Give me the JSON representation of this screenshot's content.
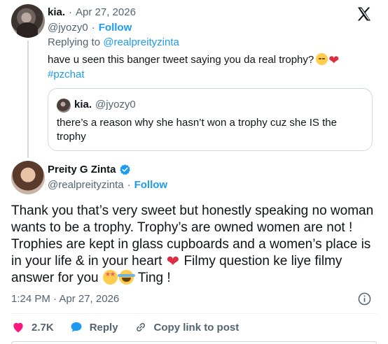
{
  "reply_tweet": {
    "display_name": "kia.",
    "date": "Apr 27, 2026",
    "handle": "@jyozy0",
    "follow_label": "Follow",
    "replying_prefix": "Replying to ",
    "replying_handle": "@realpreityzinta",
    "text": "have u seen this banger tweet saying you da real trophy?",
    "hashtag": "#pzchat",
    "emojis": [
      "relieved-face-icon",
      "red-heart-icon"
    ],
    "quoted": {
      "display_name": "kia.",
      "handle": "@jyozy0",
      "text": "there’s a reason why she hasn’t won a trophy cuz she IS the trophy"
    }
  },
  "main_tweet": {
    "display_name": "Preity G Zinta",
    "handle": "@realpreityzinta",
    "follow_label": "Follow",
    "text_part1": "Thank you that’s very sweet but honestly speaking no woman wants to be a trophy. Trophy’s are owned women are not ! Trophies are kept in glass cupboards and a women’s place is in your life & in your heart",
    "text_part2": " Filmy question ke liye filmy answer for you",
    "text_part3": " Ting !",
    "time": "1:24 PM · Apr 27, 2026",
    "like_count": "2.7K",
    "reply_label": "Reply",
    "copy_link_label": "Copy link to post"
  },
  "colors": {
    "accent": "#1d9bf0",
    "muted": "#536471",
    "like_red": "#f91880",
    "text": "#0f1419"
  }
}
